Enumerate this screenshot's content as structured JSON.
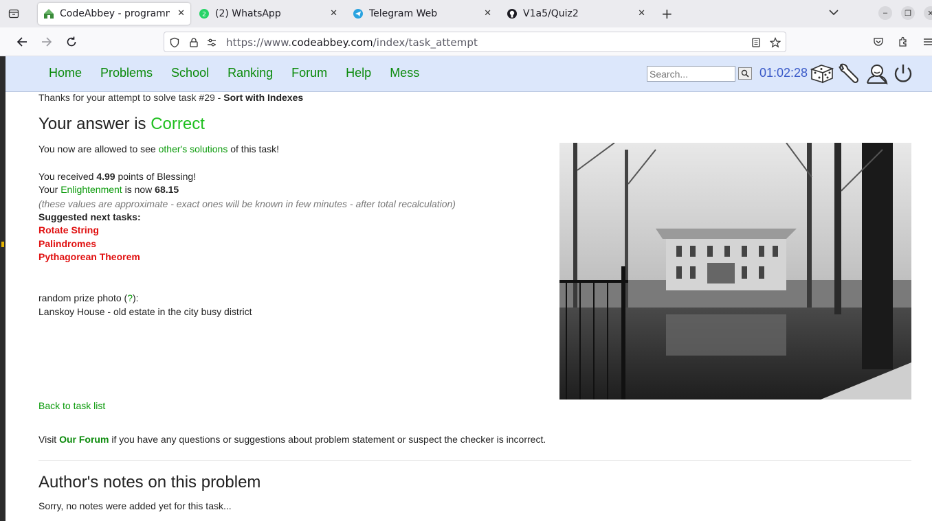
{
  "browser": {
    "tabs": [
      {
        "title": "CodeAbbey - programmir",
        "active": true
      },
      {
        "title": "(2) WhatsApp",
        "badge": "2"
      },
      {
        "title": "Telegram Web"
      },
      {
        "title": "V1a5/Quiz2"
      }
    ],
    "url_prefix": "https://www.",
    "url_host": "codeabbey.com",
    "url_path": "/index/task_attempt"
  },
  "site": {
    "nav": [
      "Home",
      "Problems",
      "School",
      "Ranking",
      "Forum",
      "Help",
      "Mess"
    ],
    "search_placeholder": "Search...",
    "clock": "01:02:28"
  },
  "result": {
    "thanks_prefix": "Thanks for your attempt to solve task #29 - ",
    "task_name": "Sort with Indexes",
    "answer_prefix": "Your answer is ",
    "answer_status": "Correct",
    "allowed_prefix": "You now are allowed to see ",
    "allowed_link": "other's solutions",
    "allowed_suffix": " of this task!",
    "received_prefix": "You received ",
    "points": "4.99",
    "received_suffix": " points of Blessing!",
    "enlight_prefix": "Your ",
    "enlight_link": "Enlightenment",
    "enlight_mid": " is now ",
    "enlight_value": "68.15",
    "approx_note": "(these values are approximate - exact ones will be known in few minutes - after total recalculation)",
    "suggested_label": "Suggested next tasks:",
    "suggested": [
      "Rotate String",
      "Palindromes",
      "Pythagorean Theorem"
    ],
    "prize_prefix": "random prize photo (",
    "prize_link": "?",
    "prize_suffix": "):",
    "prize_caption": "Lanskoy House - old estate in the city busy district",
    "back_link": "Back to task list",
    "visit_prefix": "Visit ",
    "visit_link": "Our Forum",
    "visit_suffix": " if you have any questions or suggestions about problem statement or suspect the checker is incorrect.",
    "notes_title": "Author's notes on this problem",
    "notes_text": "Sorry, no notes were added yet for this task..."
  },
  "colors": {
    "header_bg": "#dce7fb",
    "nav_link": "#0a8a0a",
    "correct": "#1fbf1f",
    "suggested": "#e01010",
    "clock": "#3a5ac8"
  }
}
